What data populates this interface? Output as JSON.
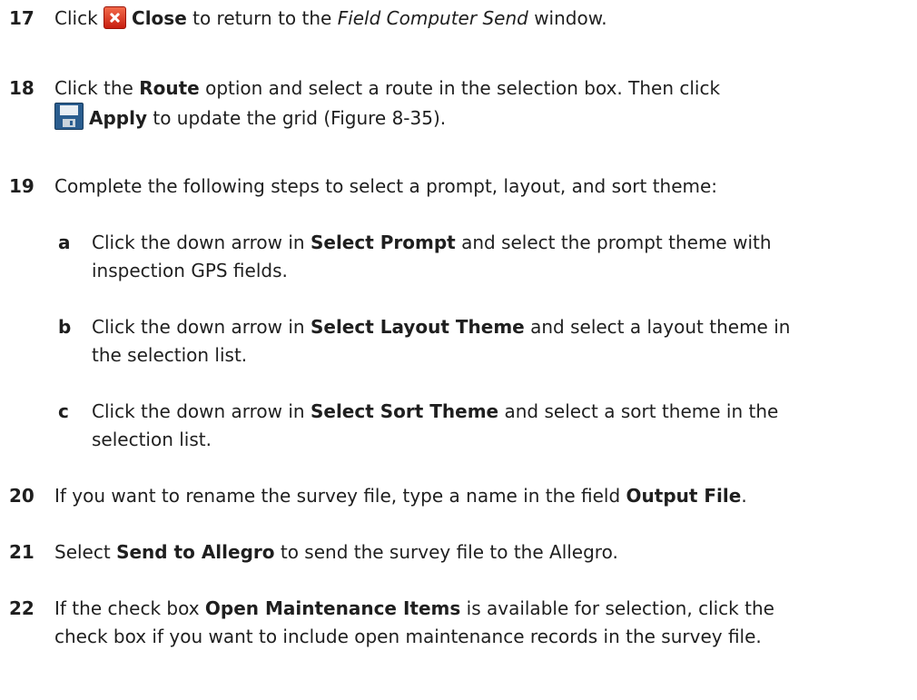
{
  "steps": {
    "s17": {
      "num": "17",
      "t1": "Click",
      "bold1": "Close",
      "t2": "to return to the",
      "ital1": "Field Computer Send",
      "t3": "window."
    },
    "s18": {
      "num": "18",
      "t1": "Click the",
      "bold1": "Route",
      "t2": "option and select a route in the selection box. Then click",
      "bold2": "Apply",
      "t3": "to update the grid (Figure 8-35)."
    },
    "s19": {
      "num": "19",
      "t1": "Complete the following steps to select a prompt, layout, and sort theme:"
    },
    "s19a": {
      "letter": "a",
      "t1": "Click the down arrow in",
      "bold1": "Select Prompt",
      "t2": "and select the prompt theme with",
      "t3": "inspection GPS fields."
    },
    "s19b": {
      "letter": "b",
      "t1": "Click the down arrow in",
      "bold1": "Select Layout Theme",
      "t2": "and select a layout theme in",
      "t3": "the selection list."
    },
    "s19c": {
      "letter": "c",
      "t1": "Click the down arrow in",
      "bold1": "Select Sort Theme",
      "t2": "and select a sort theme in the",
      "t3": "selection list."
    },
    "s20": {
      "num": "20",
      "t1": "If you want to rename the survey file, type a name in the field",
      "bold1": "Output File",
      "t2": "."
    },
    "s21": {
      "num": "21",
      "t1": "Select",
      "bold1": "Send to Allegro",
      "t2": "to send the survey file to the Allegro."
    },
    "s22": {
      "num": "22",
      "t1": "If the check box",
      "bold1": "Open Maintenance Items",
      "t2": "is available for selection, click the",
      "t3": "check box if you want to include open maintenance records in the survey file."
    }
  },
  "icons": {
    "close": "close-icon",
    "save": "save-icon"
  }
}
